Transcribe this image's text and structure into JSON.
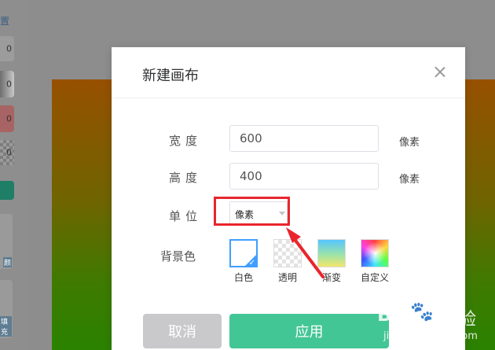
{
  "background": {
    "top_label": "置",
    "swatch_values": [
      "0",
      "0",
      "0",
      "0"
    ],
    "card1_label": "颜",
    "card2_label": "填充"
  },
  "dialog": {
    "title": "新建画布",
    "close_icon": "close-icon",
    "width_label": "宽度",
    "width_value": "600",
    "height_label": "高度",
    "height_value": "400",
    "unit_text": "像素",
    "unit_label": "单位",
    "unit_selected": "像素",
    "bgcolor_label": "背景色",
    "bg_options": [
      {
        "label": "白色",
        "selected": true
      },
      {
        "label": "透明",
        "selected": false
      },
      {
        "label": "渐变",
        "selected": false
      },
      {
        "label": "自定义",
        "selected": false
      }
    ],
    "cancel_label": "取消",
    "apply_label": "应用"
  },
  "watermark": {
    "logo": "Bai",
    "suffix": "经验",
    "url": "jingyan.baidu.com"
  },
  "colors": {
    "accent": "#409eff",
    "apply_button": "#43c695",
    "cancel_button": "#c9c9cc",
    "highlight_box": "#e9262d",
    "arrow": "#e9262d"
  }
}
